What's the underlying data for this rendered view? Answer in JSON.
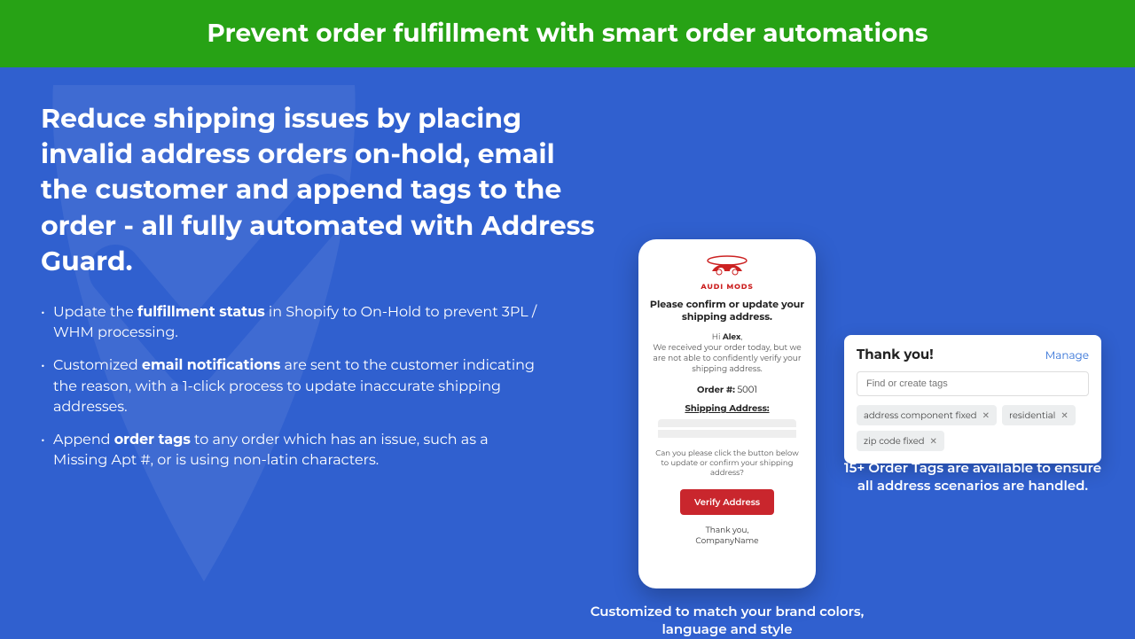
{
  "topbar": {
    "title": "Prevent order fulfillment with smart order automations"
  },
  "headline": "Reduce shipping issues by placing invalid address orders on-hold, email the customer and append tags to the order - all fully automated with Address Guard.",
  "bullets": [
    {
      "pre": "Update the ",
      "strong": "fulfillment status",
      "post": " in Shopify to On-Hold to prevent 3PL  / WHM processing."
    },
    {
      "pre": "Customized ",
      "strong": "email notifications",
      "post": " are sent to the customer indicating the reason, with a 1-click process to update inaccurate shipping addresses."
    },
    {
      "pre": "Append ",
      "strong": "order tags",
      "post": " to any order which has an issue, such as a Missing Apt #, or is using non-latin characters."
    }
  ],
  "phone": {
    "brand": "AUDI MODS",
    "header": "Please confirm or update your shipping address.",
    "greeting_pre": "Hi ",
    "greeting_name": "Alex",
    "greeting_post": ",",
    "body": "We received your order today, but we are not able to confidently verify your shipping address.",
    "order_label": "Order #:",
    "order_value": "5001",
    "shipping_header": "Shipping Address:",
    "ask": "Can you please click the button below to update or confirm your shipping address?",
    "button": "Verify Address",
    "thanks_line1": "Thank you,",
    "thanks_line2": "CompanyName",
    "caption": "Customized to match your brand colors, language and style"
  },
  "tagscard": {
    "title": "Thank you!",
    "manage": "Manage",
    "search_placeholder": "Find or create tags",
    "tags": [
      "address component fixed",
      "residential",
      "zip code fixed"
    ],
    "caption": "15+ Order Tags are available to ensure all address scenarios are handled."
  },
  "colors": {
    "accent_green": "#27a215",
    "bg_blue": "#3060cf",
    "cta_red": "#c9262d",
    "link_blue": "#2b6cd6"
  }
}
